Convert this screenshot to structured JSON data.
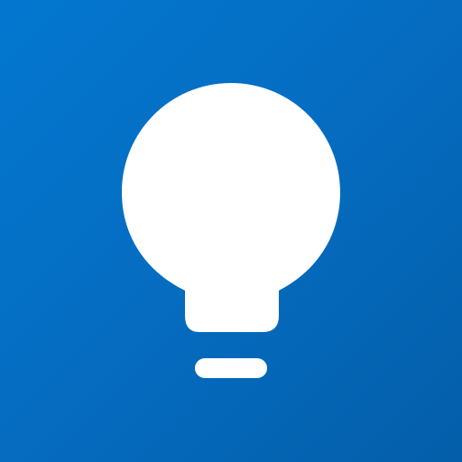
{
  "icon": {
    "name": "lightbulb-icon",
    "background_gradient": {
      "start": "#0377D0",
      "mid": "#056CC0",
      "end": "#045EA9"
    },
    "glyph_color": "#FFFFFF"
  }
}
